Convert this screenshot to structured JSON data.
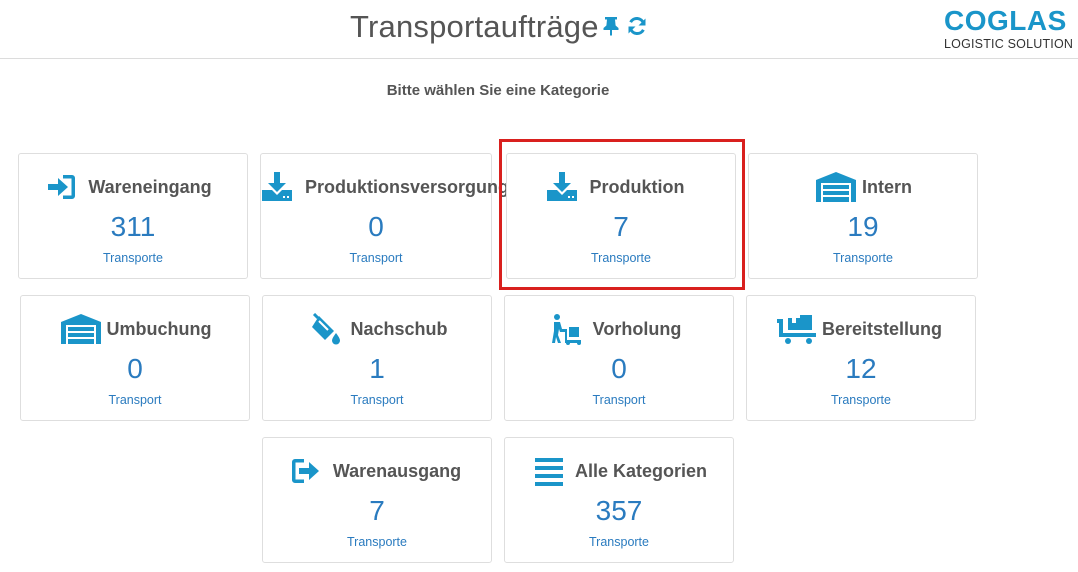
{
  "header": {
    "title": "Transportaufträge",
    "pin_icon": "pin-icon",
    "refresh_icon": "refresh-icon",
    "logo_main": "COGLAS",
    "logo_sub": "LOGISTIC SOLUTION"
  },
  "subtitle": "Bitte wählen Sie eine Kategorie",
  "colors": {
    "accent": "#1a95c9",
    "count": "#2a7bbf",
    "highlight": "#d9201e"
  },
  "categories": [
    {
      "label": "Wareneingang",
      "count": "311",
      "unit": "Transporte",
      "icon": "sign-in-icon"
    },
    {
      "label": "Produktionsversorgung",
      "count": "0",
      "unit": "Transport",
      "icon": "download-tray-icon"
    },
    {
      "label": "Produktion",
      "count": "7",
      "unit": "Transporte",
      "icon": "download-tray-icon",
      "selected": true
    },
    {
      "label": "Intern",
      "count": "19",
      "unit": "Transporte",
      "icon": "warehouse-icon"
    },
    {
      "label": "Umbuchung",
      "count": "0",
      "unit": "Transport",
      "icon": "warehouse-icon"
    },
    {
      "label": "Nachschub",
      "count": "1",
      "unit": "Transport",
      "icon": "fill-bucket-icon"
    },
    {
      "label": "Vorholung",
      "count": "0",
      "unit": "Transport",
      "icon": "dolly-worker-icon"
    },
    {
      "label": "Bereitstellung",
      "count": "12",
      "unit": "Transporte",
      "icon": "dolly-flatbed-icon"
    },
    {
      "label": "Warenausgang",
      "count": "7",
      "unit": "Transporte",
      "icon": "sign-out-icon"
    },
    {
      "label": "Alle Kategorien",
      "count": "357",
      "unit": "Transporte",
      "icon": "list-icon"
    }
  ]
}
